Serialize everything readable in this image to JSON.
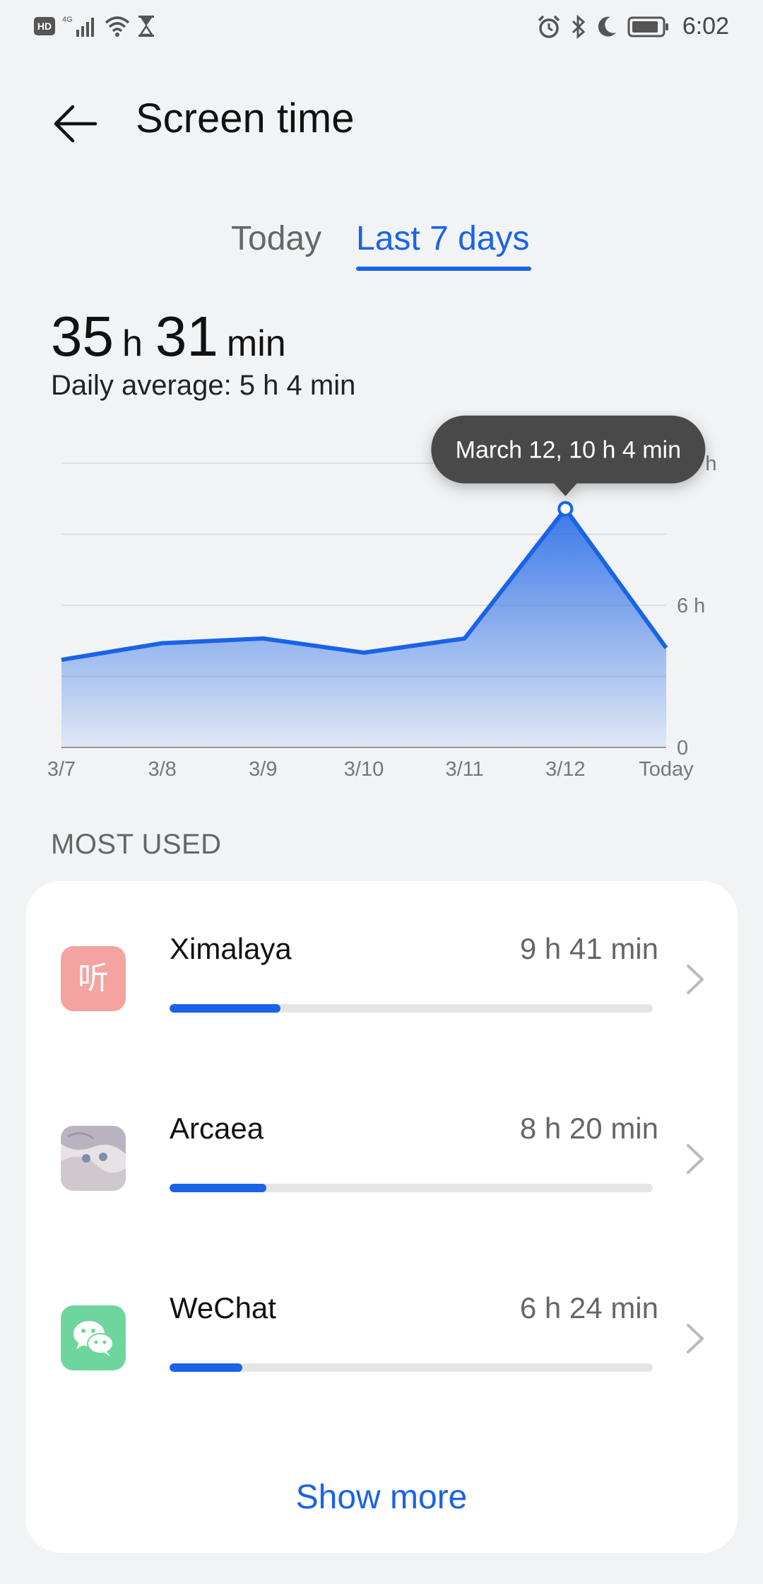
{
  "status_bar": {
    "left_badge": "HD",
    "network": "4G",
    "time": "6:02",
    "icons": [
      "hd-icon",
      "signal-icon",
      "wifi-icon",
      "hourglass-icon",
      "alarm-icon",
      "bluetooth-icon",
      "moon-icon",
      "battery-icon"
    ]
  },
  "header": {
    "back_icon": "arrow-left-icon",
    "title": "Screen time"
  },
  "tabs": [
    {
      "label": "Today",
      "selected": false
    },
    {
      "label": "Last 7 days",
      "selected": true
    }
  ],
  "summary": {
    "hours": "35",
    "hours_unit": "h",
    "minutes": "31",
    "minutes_unit": "min",
    "daily_average": "Daily average: 5 h 4 min"
  },
  "tooltip": {
    "text": "March 12, 10 h 4 min"
  },
  "chart_data": {
    "type": "area",
    "categories": [
      "3/7",
      "3/8",
      "3/9",
      "3/10",
      "3/11",
      "3/12",
      "Today"
    ],
    "series": [
      {
        "values": [
          3.7,
          4.4,
          4.6,
          4.0,
          4.6,
          10.07,
          4.2
        ]
      }
    ],
    "y_ticks": [
      "0",
      "6 h",
      "12 h"
    ],
    "ylim": [
      0,
      12
    ],
    "highlight_index": 5,
    "grid": true,
    "color": "#1a63e6"
  },
  "most_used": {
    "header": "MOST USED",
    "apps": [
      {
        "name": "Ximalaya",
        "time": "9 h 41 min",
        "progress": 0.23,
        "icon": "ximalaya-icon",
        "icon_glyph": "听",
        "icon_color": "#f4a3a0"
      },
      {
        "name": "Arcaea",
        "time": "8 h 20 min",
        "progress": 0.2,
        "icon": "arcaea-icon",
        "icon_color": "#d8d4d8"
      },
      {
        "name": "WeChat",
        "time": "6 h 24 min",
        "progress": 0.15,
        "icon": "wechat-icon",
        "icon_color": "#6ed69c"
      }
    ],
    "show_more": "Show more"
  }
}
